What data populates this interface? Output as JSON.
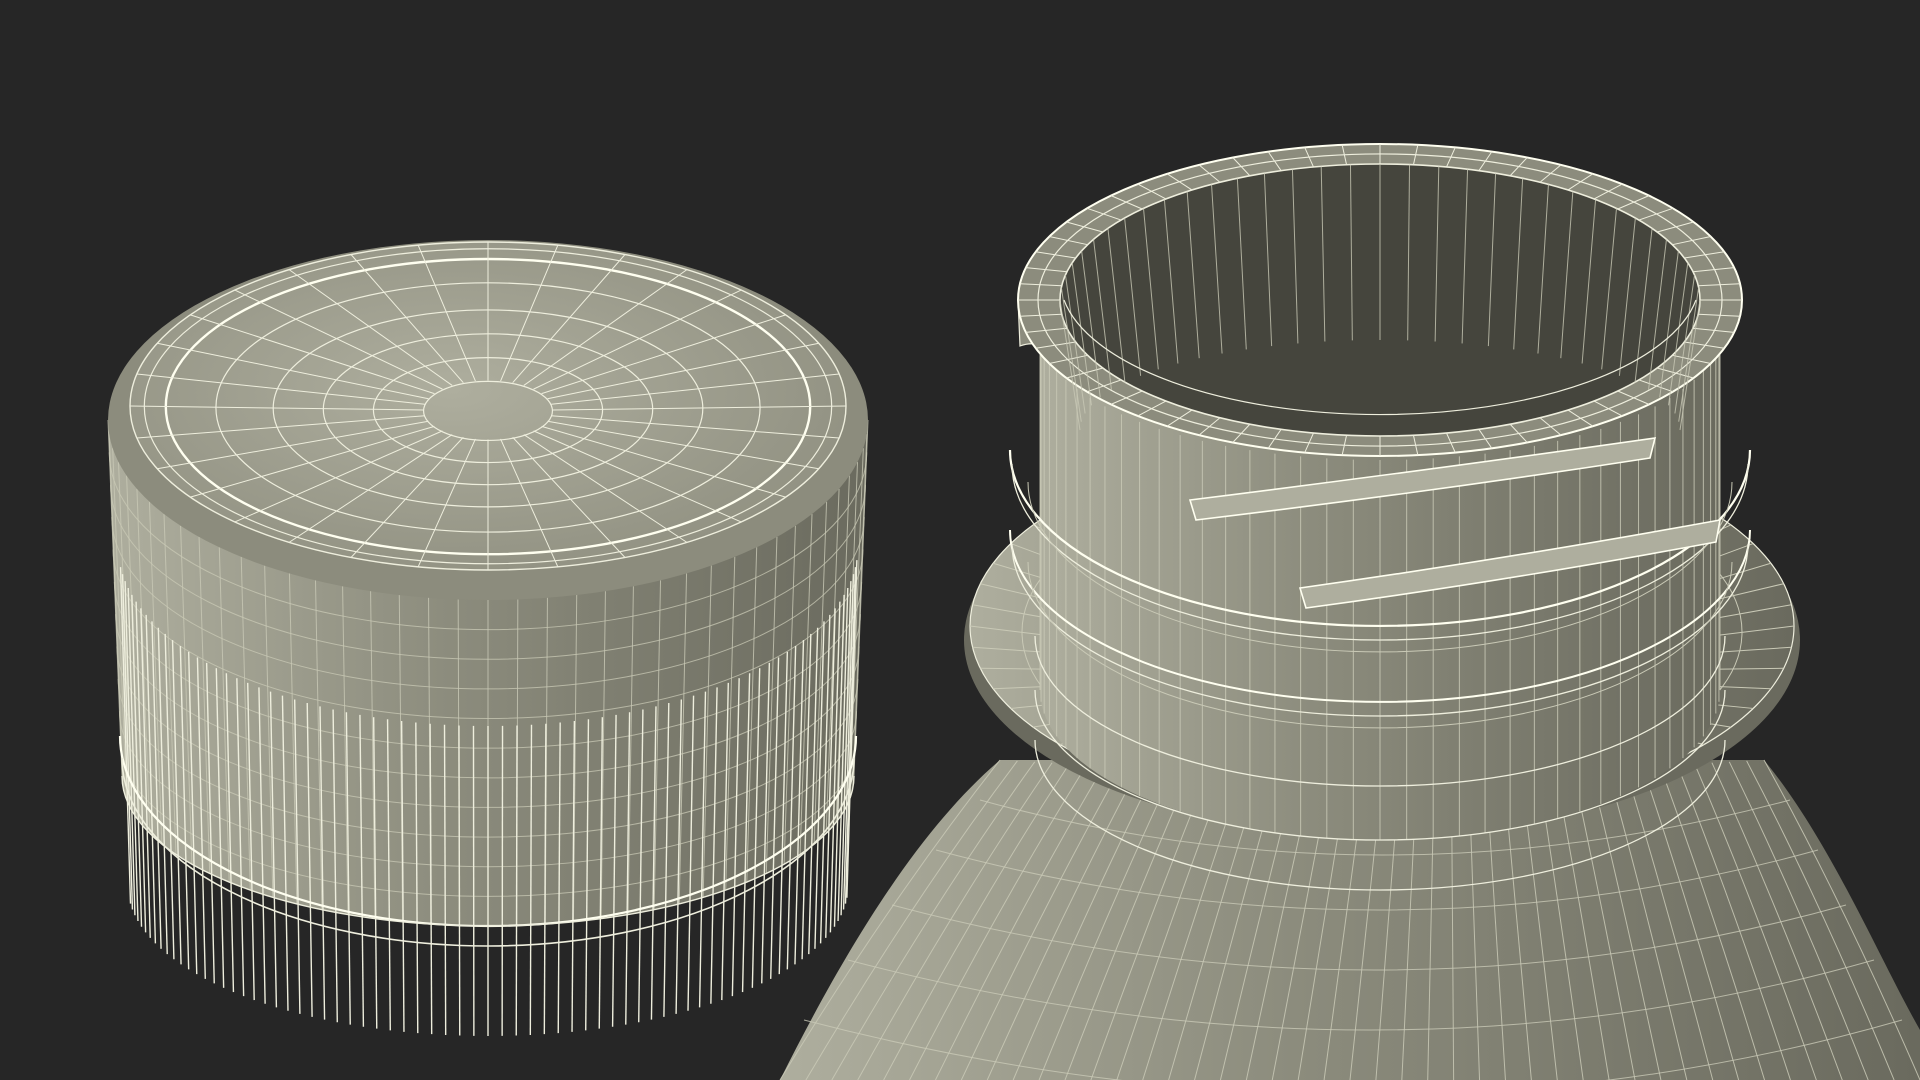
{
  "scene": {
    "subjects": [
      "bottle-cap",
      "bottle-neck"
    ],
    "view_mode": "wireframe-on-shaded",
    "text_visible": "none"
  },
  "colors": {
    "background": "#262626",
    "surface_light": "#aeae9e",
    "surface_mid": "#8c8c7d",
    "surface_dark": "#6a6a5e",
    "cavity": "#45453d",
    "wire": "#eeeedd",
    "wire_soft": "#c9c9b6",
    "highlight": "#fffff0"
  }
}
